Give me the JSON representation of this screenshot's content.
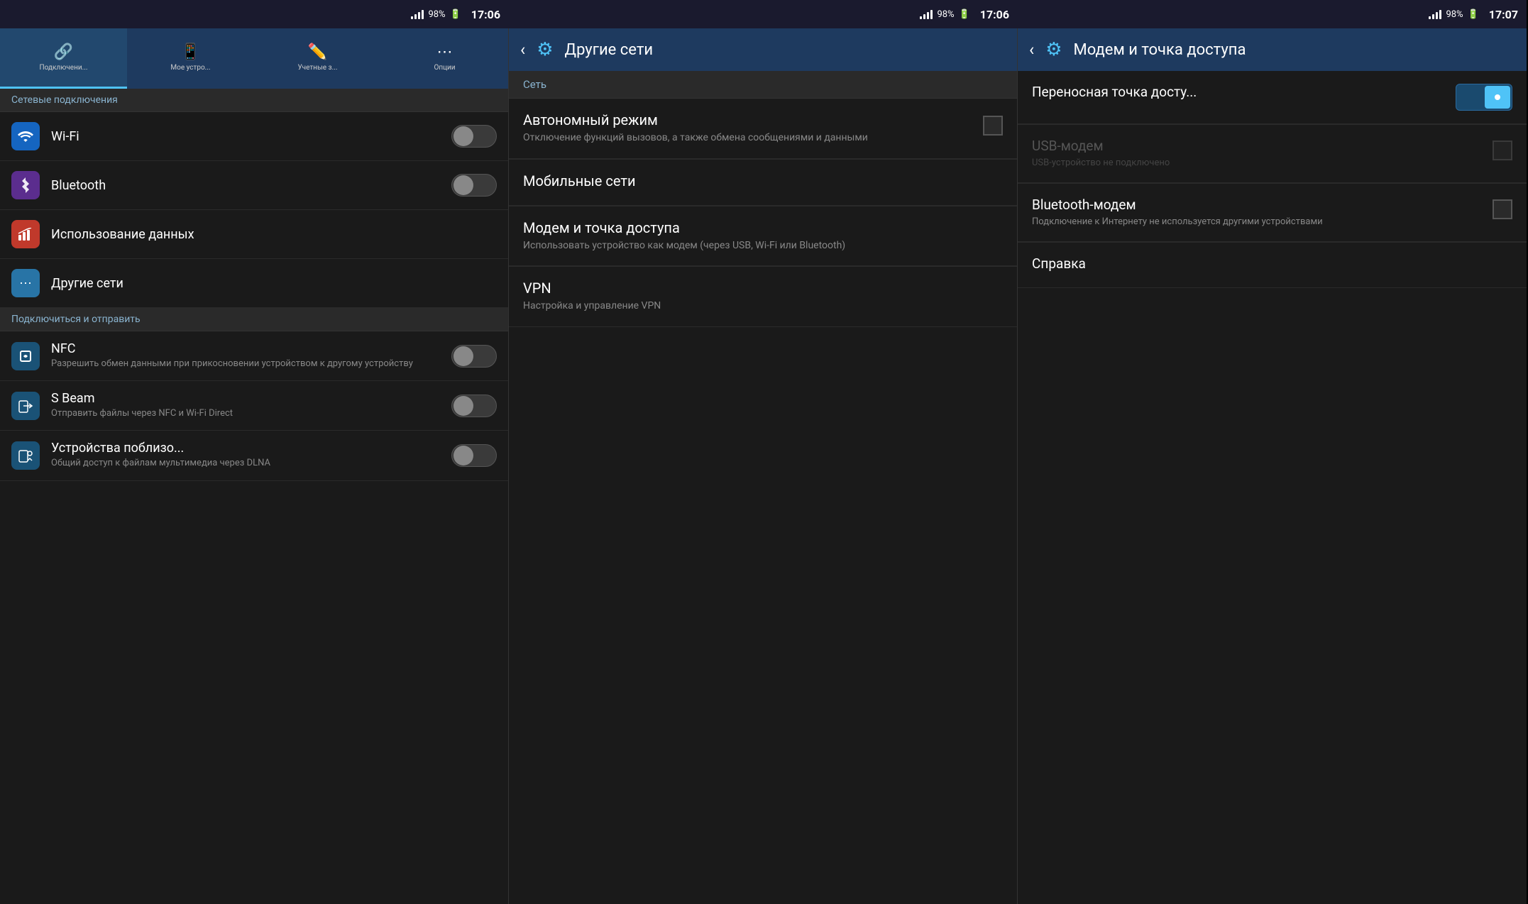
{
  "panels": [
    {
      "id": "panel-left",
      "statusBar": {
        "battery": "98%",
        "time": "17:06"
      },
      "tabs": [
        {
          "id": "tab-connections",
          "label": "Подключени...",
          "icon": "🔗",
          "active": true
        },
        {
          "id": "tab-mydevice",
          "label": "Мое устро...",
          "icon": "📱",
          "active": false
        },
        {
          "id": "tab-accounts",
          "label": "Учетные з...",
          "icon": "✏️",
          "active": false
        },
        {
          "id": "tab-options",
          "label": "Опции",
          "icon": "⋯",
          "active": false
        }
      ],
      "sectionHeader": "Сетевые подключения",
      "networkItems": [
        {
          "id": "wifi",
          "icon": "wifi",
          "title": "Wi-Fi",
          "toggle": true,
          "on": false
        },
        {
          "id": "bluetooth",
          "icon": "bt",
          "title": "Bluetooth",
          "toggle": true,
          "on": false
        }
      ],
      "items": [
        {
          "id": "data-usage",
          "icon": "data",
          "title": "Использование данных",
          "toggle": false
        },
        {
          "id": "other-networks",
          "icon": "other",
          "title": "Другие сети",
          "toggle": false
        }
      ],
      "section2Header": "Подключиться и отправить",
      "connectItems": [
        {
          "id": "nfc",
          "icon": "nfc",
          "title": "NFC",
          "subtitle": "Разрешить обмен данными при прикосновении устройством к другому устройству",
          "toggle": true,
          "on": false
        },
        {
          "id": "sbeam",
          "icon": "sbeam",
          "title": "S Beam",
          "subtitle": "Отправить файлы через NFC и Wi-Fi Direct",
          "toggle": true,
          "on": false
        },
        {
          "id": "nearby",
          "icon": "nearby",
          "title": "Устройства поблизо...",
          "subtitle": "Общий доступ к файлам мультимедиа через DLNA",
          "toggle": true,
          "on": false
        }
      ]
    },
    {
      "id": "panel-middle",
      "statusBar": {
        "battery": "98%",
        "time": "17:06"
      },
      "header": {
        "title": "Другие сети",
        "backLabel": "‹",
        "gearIcon": "⚙"
      },
      "subSectionHeader": "Сеть",
      "menuItems": [
        {
          "id": "autonomous",
          "title": "Автономный режим",
          "desc": "Отключение функций вызовов, а также обмена сообщениями и данными",
          "hasCheckbox": true
        },
        {
          "id": "mobile-networks",
          "title": "Мобильные сети",
          "desc": "",
          "hasCheckbox": false
        },
        {
          "id": "hotspot",
          "title": "Модем и точка доступа",
          "desc": "Использовать устройство как модем (через USB, Wi-Fi или Bluetooth)",
          "hasCheckbox": false
        },
        {
          "id": "vpn",
          "title": "VPN",
          "desc": "Настройка и управление VPN",
          "hasCheckbox": false
        }
      ]
    },
    {
      "id": "panel-right",
      "statusBar": {
        "battery": "98%",
        "time": "17:07"
      },
      "header": {
        "title": "Модем и точка доступа",
        "backLabel": "‹",
        "gearIcon": "⚙"
      },
      "items": [
        {
          "id": "portable-hotspot",
          "title": "Переносная точка досту...",
          "subtitle": "",
          "toggleBtn": true,
          "disabled": false
        },
        {
          "id": "usb-modem",
          "title": "USB-модем",
          "subtitle": "USB-устройство не подключено",
          "checkbox": true,
          "disabled": true
        },
        {
          "id": "bt-modem",
          "title": "Bluetooth-модем",
          "subtitle": "Подключение к Интернету не используется другими устройствами",
          "checkbox": true,
          "disabled": false
        },
        {
          "id": "help",
          "title": "Справка",
          "subtitle": "",
          "checkbox": false,
          "disabled": false
        }
      ]
    }
  ]
}
